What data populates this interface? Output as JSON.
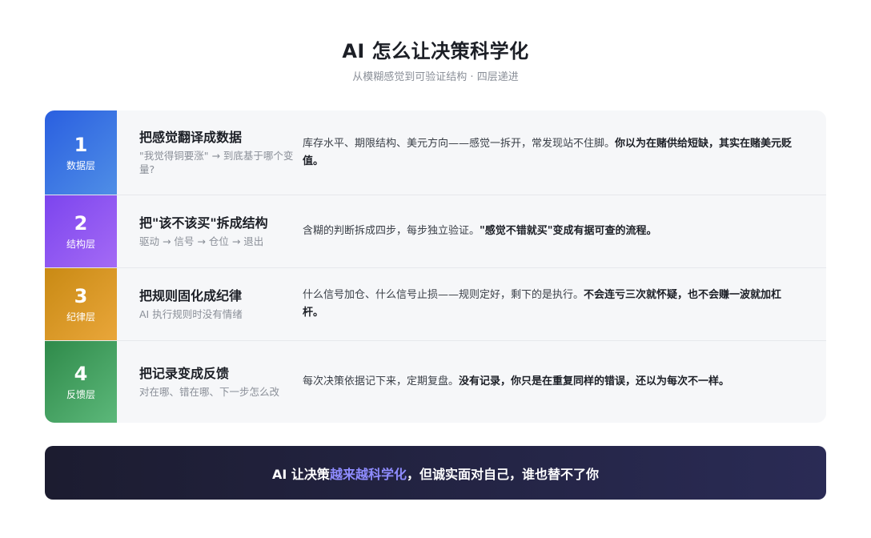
{
  "header": {
    "title": "AI 怎么让决策科学化",
    "subtitle": "从模糊感觉到可验证结构 · 四层递进"
  },
  "layers": [
    {
      "num": "1",
      "label": "数据层",
      "heading": "把感觉翻译成数据",
      "sub": "\"我觉得铜要涨\" → 到底基于哪个变量?",
      "desc": "库存水平、期限结构、美元方向——感觉一拆开，常发现站不住脚。",
      "desc_bold": "你以为在赌供给短缺，其实在赌美元贬值。",
      "color": "#2a5fe0"
    },
    {
      "num": "2",
      "label": "结构层",
      "heading": "把\"该不该买\"拆成结构",
      "sub": "驱动 → 信号 → 仓位 → 退出",
      "desc": "含糊的判断拆成四步，每步独立验证。",
      "desc_bold": "\"感觉不错就买\"变成有据可查的流程。",
      "color": "#7c45ee"
    },
    {
      "num": "3",
      "label": "纪律层",
      "heading": "把规则固化成纪律",
      "sub": "AI 执行规则时没有情绪",
      "desc": "什么信号加仓、什么信号止损——规则定好，剩下的是执行。",
      "desc_bold": "不会连亏三次就怀疑，也不会赚一波就加杠杆。",
      "color": "#c98a14"
    },
    {
      "num": "4",
      "label": "反馈层",
      "heading": "把记录变成反馈",
      "sub": "对在哪、错在哪、下一步怎么改",
      "desc": "每次决策依据记下来，定期复盘。",
      "desc_bold": "没有记录，你只是在重复同样的错误，还以为每次不一样。",
      "color": "#2f8a4a"
    }
  ],
  "banner": {
    "prefix": "AI 让决策",
    "highlight": "越来越科学化",
    "suffix": "，但诚实面对自己，谁也替不了你",
    "highlight_color": "#8f8cff"
  }
}
